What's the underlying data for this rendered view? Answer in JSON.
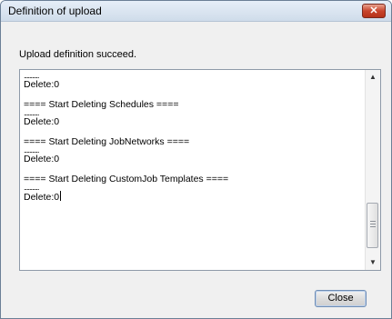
{
  "window": {
    "title": "Definition of upload",
    "close_glyph": "✕"
  },
  "message": "Upload definition succeed.",
  "log": {
    "lines": [
      {
        "text": "...........",
        "kind": "dots"
      },
      {
        "text": "Delete:0",
        "kind": "text"
      },
      {
        "text": "",
        "kind": "blank"
      },
      {
        "text": "==== Start Deleting Schedules ====",
        "kind": "text"
      },
      {
        "text": "...........",
        "kind": "dots"
      },
      {
        "text": "Delete:0",
        "kind": "text"
      },
      {
        "text": "",
        "kind": "blank"
      },
      {
        "text": "==== Start Deleting JobNetworks ====",
        "kind": "text"
      },
      {
        "text": "...........",
        "kind": "dots"
      },
      {
        "text": "Delete:0",
        "kind": "text"
      },
      {
        "text": "",
        "kind": "blank"
      },
      {
        "text": "==== Start Deleting CustomJob Templates ====",
        "kind": "text"
      },
      {
        "text": "...........",
        "kind": "dots"
      },
      {
        "text": "Delete:0",
        "kind": "text"
      }
    ],
    "scroll_up_icon": "▲",
    "scroll_down_icon": "▼"
  },
  "buttons": {
    "close_label": "Close"
  }
}
